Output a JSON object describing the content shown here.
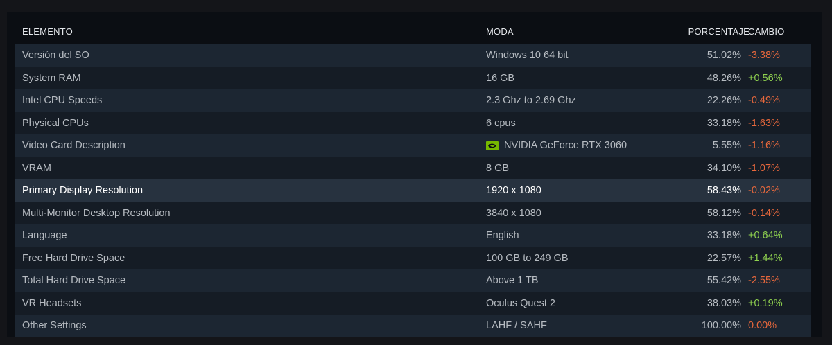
{
  "header": {
    "col_element": "ELEMENTO",
    "col_mode": "MODA",
    "col_percent": "PORCENTAJE",
    "col_change": "CAMBIO"
  },
  "rows": [
    {
      "element": "Versión del SO",
      "mode": "Windows 10 64 bit",
      "percent": "51.02%",
      "change": "-3.38%",
      "trend": "neg"
    },
    {
      "element": "System RAM",
      "mode": "16 GB",
      "percent": "48.26%",
      "change": "+0.56%",
      "trend": "pos"
    },
    {
      "element": "Intel CPU Speeds",
      "mode": "2.3 Ghz to 2.69 Ghz",
      "percent": "22.26%",
      "change": "-0.49%",
      "trend": "neg"
    },
    {
      "element": "Physical CPUs",
      "mode": "6 cpus",
      "percent": "33.18%",
      "change": "-1.63%",
      "trend": "neg"
    },
    {
      "element": "Video Card Description",
      "mode": "NVIDIA GeForce RTX 3060",
      "percent": "5.55%",
      "change": "-1.16%",
      "trend": "neg",
      "icon": "nvidia-logo-icon"
    },
    {
      "element": "VRAM",
      "mode": "8 GB",
      "percent": "34.10%",
      "change": "-1.07%",
      "trend": "neg"
    },
    {
      "element": "Primary Display Resolution",
      "mode": "1920 x 1080",
      "percent": "58.43%",
      "change": "-0.02%",
      "trend": "neg",
      "highlighted": true
    },
    {
      "element": "Multi-Monitor Desktop Resolution",
      "mode": "3840 x 1080",
      "percent": "58.12%",
      "change": "-0.14%",
      "trend": "neg"
    },
    {
      "element": "Language",
      "mode": "English",
      "percent": "33.18%",
      "change": "+0.64%",
      "trend": "pos"
    },
    {
      "element": "Free Hard Drive Space",
      "mode": "100 GB to 249 GB",
      "percent": "22.57%",
      "change": "+1.44%",
      "trend": "pos"
    },
    {
      "element": "Total Hard Drive Space",
      "mode": "Above 1 TB",
      "percent": "55.42%",
      "change": "-2.55%",
      "trend": "neg"
    },
    {
      "element": "VR Headsets",
      "mode": "Oculus Quest 2",
      "percent": "38.03%",
      "change": "+0.19%",
      "trend": "pos"
    },
    {
      "element": "Other Settings",
      "mode": "LAHF / SAHF",
      "percent": "100.00%",
      "change": "0.00%",
      "trend": "zero"
    }
  ],
  "colors": {
    "negative": "#e8683c",
    "positive": "#8fd14f",
    "nvidia_green": "#76b900"
  }
}
